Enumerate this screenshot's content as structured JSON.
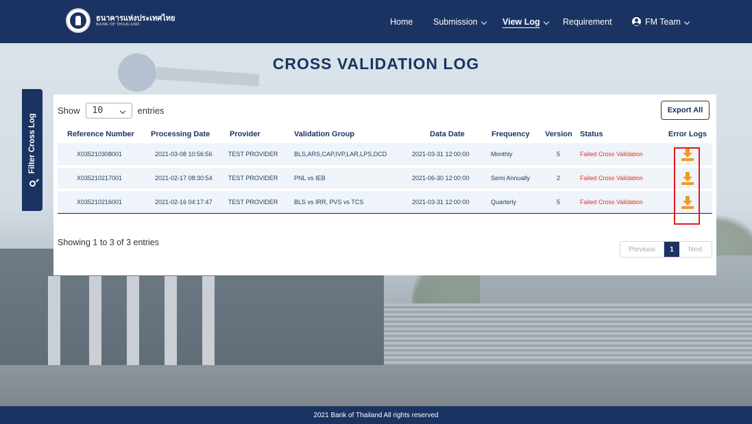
{
  "brand": {
    "thai_name": "ธนาคารแห่งประเทศไทย",
    "english_name": "BANK OF THAILAND"
  },
  "nav": {
    "home": "Home",
    "submission": "Submission",
    "view_log": "View Log",
    "requirement": "Requirement",
    "user": "FM Team"
  },
  "page": {
    "title": "CROSS VALIDATION LOG"
  },
  "filter": {
    "label": "Filter Cross Log",
    "icon": "search-icon"
  },
  "table_controls": {
    "show_label": "Show",
    "entries_value": "10",
    "entries_label": "entries",
    "export_label": "Export All"
  },
  "table": {
    "headers": [
      "Reference Number",
      "Processing Date",
      "Provider",
      "Validation Group",
      "Data Date",
      "Frequency",
      "Version",
      "Status",
      "Error Logs"
    ],
    "rows": [
      {
        "ref": "X035210308001",
        "processing_date": "2021-03-08 10:56:56",
        "provider": "TEST PROVIDER",
        "group": "BLS,ARS,CAP,IVP,LAR,LPS,DCD",
        "data_date": "2021-03-31 12:00:00",
        "frequency": "Monthly",
        "version": "5",
        "status": "Failed Cross Validation",
        "error_icon": "download-icon"
      },
      {
        "ref": "X035210217001",
        "processing_date": "2021-02-17 08:30:54",
        "provider": "TEST PROVIDER",
        "group": "PNL vs IEB",
        "data_date": "2021-06-30 12:00:00",
        "frequency": "Semi Annually",
        "version": "2",
        "status": "Failed Cross Validation",
        "error_icon": "download-icon"
      },
      {
        "ref": "X035210216001",
        "processing_date": "2021-02-16 04:17:47",
        "provider": "TEST PROVIDER",
        "group": "BLS vs IRR, PVS vs TCS",
        "data_date": "2021-03-31 12:00:00",
        "frequency": "Quarterly",
        "version": "5",
        "status": "Failed Cross Validation",
        "error_icon": "download-icon"
      }
    ],
    "info": "Showing 1 to 3 of 3 entries"
  },
  "pagination": {
    "previous": "Previous",
    "current": "1",
    "next": "Next"
  },
  "footer": {
    "text": "2021 Bank of Thailand All rights reserved"
  },
  "colors": {
    "primary": "#1b3362",
    "status_failed": "#e0302b",
    "download": "#f29a1f",
    "highlight": "#e3171a"
  }
}
